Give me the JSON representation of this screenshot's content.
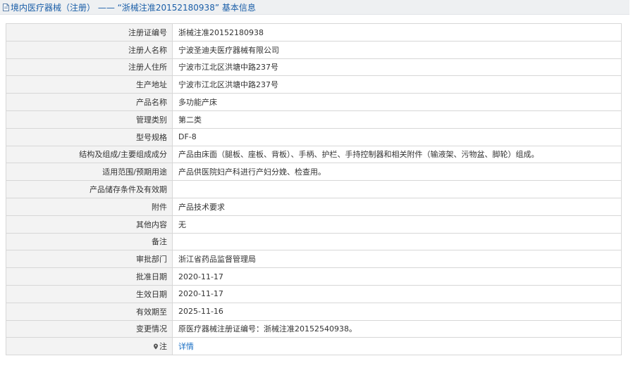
{
  "header": {
    "title": "境内医疗器械（注册） —— “浙械注准20152180938” 基本信息",
    "icon": "document-icon"
  },
  "rows": [
    {
      "label": "注册证编号",
      "value": "浙械注准20152180938"
    },
    {
      "label": "注册人名称",
      "value": "宁波圣迪夫医疗器械有限公司"
    },
    {
      "label": "注册人住所",
      "value": "宁波市江北区洪塘中路237号"
    },
    {
      "label": "生产地址",
      "value": "宁波市江北区洪塘中路237号"
    },
    {
      "label": "产品名称",
      "value": "多功能产床"
    },
    {
      "label": "管理类别",
      "value": "第二类"
    },
    {
      "label": "型号规格",
      "value": "DF-8"
    },
    {
      "label": "结构及组成/主要组成成分",
      "value": "产品由床面（腿板、座板、背板）、手柄、护栏、手持控制器和相关附件（输液架、污物盆、脚轮）组成。"
    },
    {
      "label": "适用范围/预期用途",
      "value": "产品供医院妇产科进行产妇分娩、检查用。"
    },
    {
      "label": "产品储存条件及有效期",
      "value": ""
    },
    {
      "label": "附件",
      "value": "产品技术要求"
    },
    {
      "label": "其他内容",
      "value": "无"
    },
    {
      "label": "备注",
      "value": ""
    },
    {
      "label": "审批部门",
      "value": "浙江省药品监督管理局"
    },
    {
      "label": "批准日期",
      "value": "2020-11-17"
    },
    {
      "label": "生效日期",
      "value": "2020-11-17"
    },
    {
      "label": "有效期至",
      "value": "2025-11-16"
    },
    {
      "label": "变更情况",
      "value": "原医疗器械注册证编号：浙械注准20152540938。"
    }
  ],
  "note_row": {
    "icon": "pin-icon",
    "label": "注",
    "link_text": "详情"
  },
  "colors": {
    "title": "#1a5ea8",
    "link": "#1a6fc4",
    "label_bg": "#f3f3f3",
    "border": "#d7d7d7"
  }
}
